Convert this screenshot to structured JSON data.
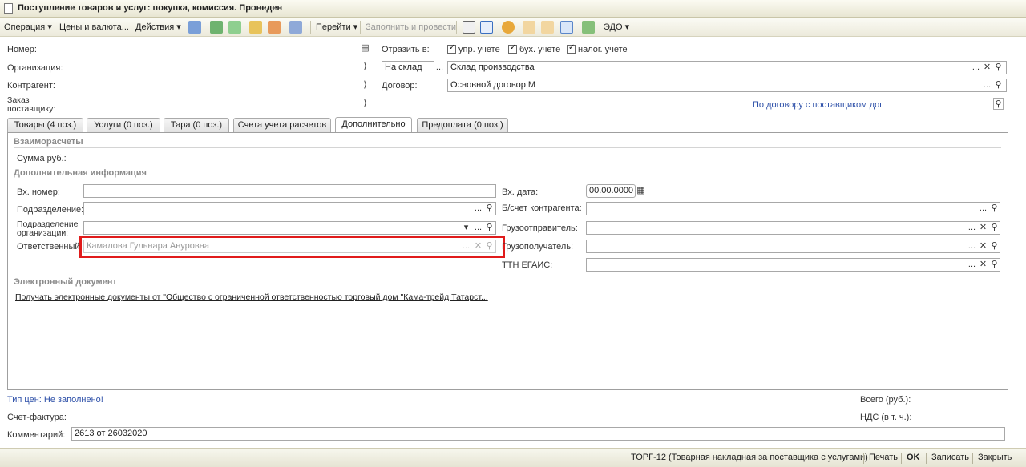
{
  "window": {
    "title": "Поступление товаров и услуг: покупка, комиссия. Проведен"
  },
  "toolbar": {
    "operation": "Операция",
    "prices": "Цены и валюта...",
    "actions": "Действия",
    "goto": "Перейти",
    "fill_post": "Заполнить и провести",
    "edo": "ЭДО",
    "arrow": "▾"
  },
  "header": {
    "number_label": "Номер:",
    "org_label": "Организация:",
    "contractor_label": "Контрагент:",
    "order_label": "Заказ поставщику:",
    "reflect_label": "Отразить в:",
    "chk_upr": "упр. учете",
    "chk_buh": "бух. учете",
    "chk_nalog": "налог. учете",
    "warehouse_type": "На склад",
    "warehouse": "Склад производства",
    "contract_label": "Договор:",
    "contract": "Основной договор М",
    "by_contract_link": "По договору с поставщиком дог"
  },
  "tabs": [
    {
      "label": "Товары (4 поз.)"
    },
    {
      "label": "Услуги (0 поз.)"
    },
    {
      "label": "Тара (0 поз.)"
    },
    {
      "label": "Счета учета расчетов"
    },
    {
      "label": "Дополнительно"
    },
    {
      "label": "Предоплата (0 поз.)"
    }
  ],
  "settlements": {
    "section": "Взаиморасчеты",
    "amount_label": "Сумма руб.:"
  },
  "extra": {
    "section": "Дополнительная информация",
    "in_number_label": "Вх. номер:",
    "subdivision_label": "Подразделение:",
    "org_subdivision_label": "Подразделение организации:",
    "responsible_label": "Ответственный:",
    "responsible_value": "Камалова Гульнара Ануровна",
    "in_date_label": "Вх. дата:",
    "in_date_value": "00.00.0000",
    "contractor_account_label": "Б/счет контрагента:",
    "shipper_label": "Грузоотправитель:",
    "consignee_label": "Грузополучатель:",
    "ttn_label": "ТТН ЕГАИС:"
  },
  "edoc": {
    "section": "Электронный документ",
    "link": "Получать электронные документы от \"Общество с ограниченной ответственностью торговый дом \"Кама-трейд Татарст..."
  },
  "footer": {
    "price_type": "Тип цен: Не заполнено!",
    "invoice_label": "Счет-фактура:",
    "comment_label": "Комментарий:",
    "comment_value": "2613 от 26032020",
    "total_label": "Всего (руб.):",
    "vat_label": "НДС (в т. ч.):"
  },
  "statusbar": {
    "torg12": "ТОРГ-12 (Товарная накладная за поставщика с услугами)",
    "print": "Печать",
    "ok": "OK",
    "save": "Записать",
    "close": "Закрыть"
  },
  "icons": {
    "dots": "...",
    "clear": "✕",
    "search": "🔍",
    "dropdown": "▾",
    "calendar": "▦"
  }
}
